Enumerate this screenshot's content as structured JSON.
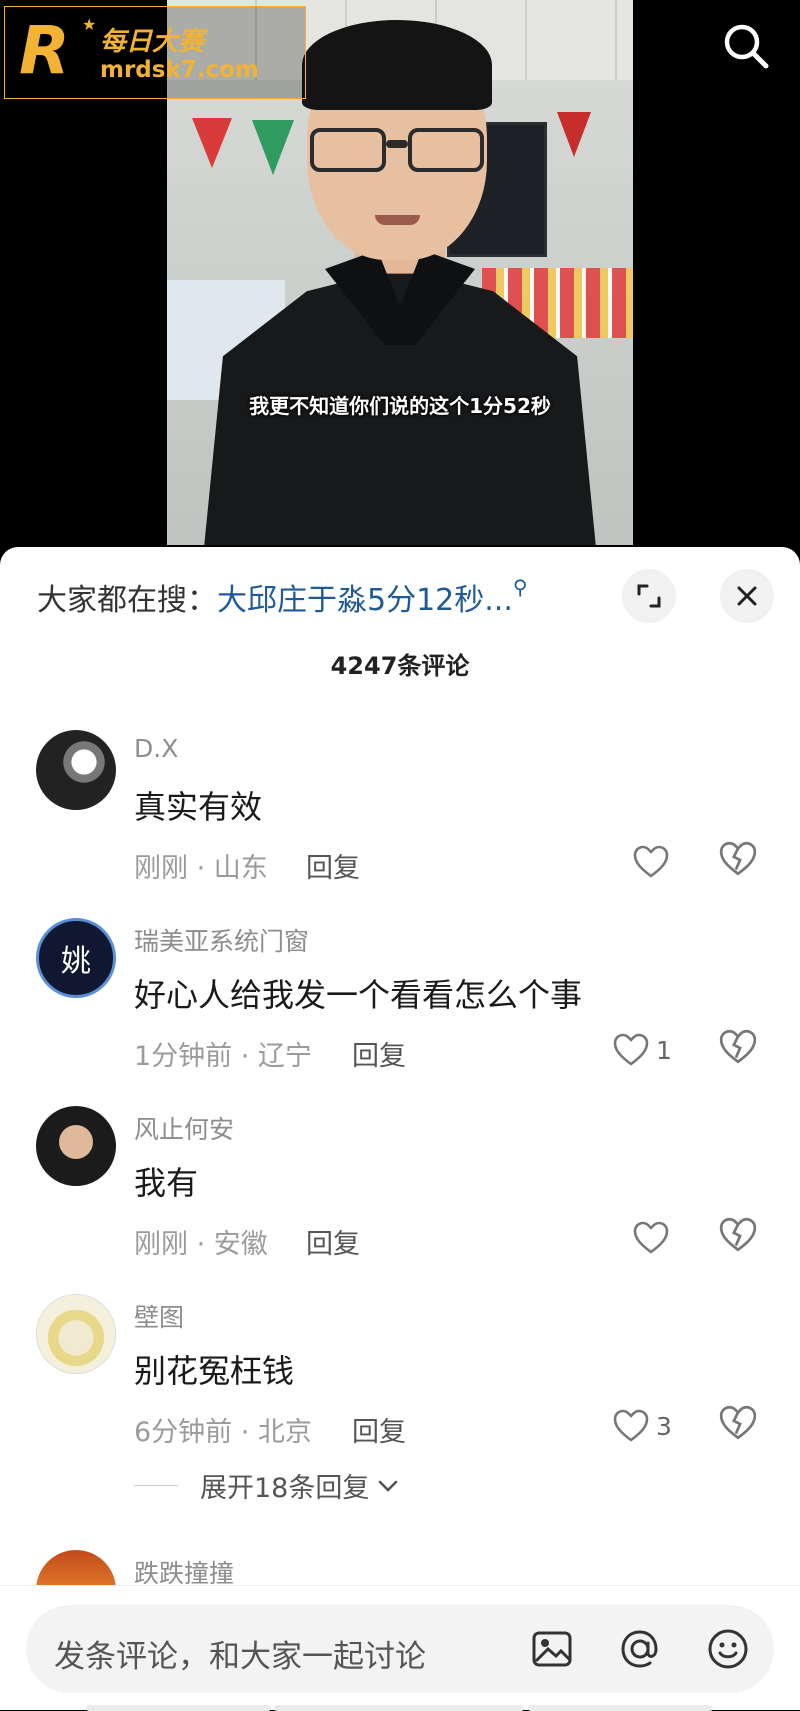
{
  "video": {
    "subtitle": "我更不知道你们说的这个1分52秒"
  },
  "watermark": {
    "logo_letter": "R",
    "title": "每日大赛",
    "url": "mrdsk7.com"
  },
  "header": {
    "search_icon": "search-icon"
  },
  "comments_panel": {
    "trend_prefix": "大家都在搜：",
    "trend_query": "大邱庄于淼5分12秒...",
    "count_label": "4247条评论",
    "reply_label": "回复",
    "comments": [
      {
        "user": "D.X",
        "text": "真实有效",
        "meta": "刚刚 · 山东",
        "likes": ""
      },
      {
        "user": "瑞美亚系统门窗",
        "text": "好心人给我发一个看看怎么个事",
        "meta": "1分钟前 · 辽宁",
        "likes": "1"
      },
      {
        "user": "风止何安",
        "text": "我有",
        "meta": "刚刚 · 安徽",
        "likes": ""
      },
      {
        "user": "壁图",
        "text": "别花冤枉钱",
        "meta": "6分钟前 · 北京",
        "likes": "3"
      },
      {
        "user": "跌跌撞撞",
        "text": "",
        "meta": "",
        "likes": ""
      }
    ],
    "expand_replies": "展开18条回复",
    "avatar_badge": "姚"
  },
  "input_bar": {
    "placeholder": "发条评论，和大家一起讨论",
    "icons": [
      "image-icon",
      "at-icon",
      "emoji-icon"
    ]
  },
  "colors": {
    "link": "#1f5a96",
    "logo": "#f2b233"
  }
}
